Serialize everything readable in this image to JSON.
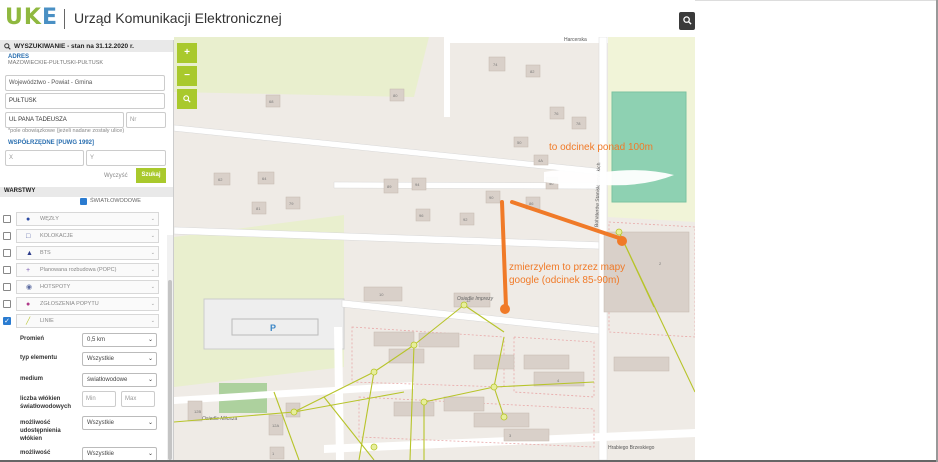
{
  "header": {
    "logo_u": "U",
    "logo_k": "K",
    "logo_e": "E",
    "title": "Urząd Komunikacji Elektronicznej",
    "search_icon": "search-icon"
  },
  "map": {
    "streets": [
      "Harcerska",
      "Bohaterów Stanisławowskich",
      "Hrabiego Brzeskiego"
    ],
    "places": [
      "Osiedle Imprezy",
      "Osiedle Miłosza"
    ],
    "house_numbers": [
      "68",
      "80",
      "74",
      "82",
      "76",
      "78",
      "62",
      "64",
      "79",
      "81",
      "89",
      "94",
      "96",
      "92",
      "90",
      "86",
      "40",
      "50",
      "4A",
      "10",
      "12",
      "48",
      "12B",
      "12A",
      "1",
      "2",
      "3",
      "4"
    ],
    "parking_label": "P",
    "colors": {
      "background": "#efebe6",
      "road": "#ffffff",
      "building": "#d9d0c9",
      "green": "#add19e",
      "sport": "#8ed1b2",
      "field": "#e9efce",
      "fiber_line": "#b7c42a",
      "annotation": "#f07a28",
      "parcel": "#e8a8a8"
    },
    "zoom_in": "+",
    "zoom_out": "−",
    "locate": "locate-icon"
  },
  "annotations": {
    "top": "to odcinek ponad 100m",
    "bottom": "zmierzylem to przez mapy google (odcinek 85-90m)"
  },
  "search_panel": {
    "title": "WYSZUKIWANIE - stan na 31.12.2020 r.",
    "address_label": "ADRES",
    "location": "MAZOWIECKIE-PUŁTUSKI-PUŁTUSK",
    "region_placeholder": "Województwo - Powiat - Gmina",
    "city_value": "PUŁTUSK",
    "street_value": "UL PANA TADEUSZA",
    "number_placeholder": "Nr",
    "required_note": "*pole obowiązkowe (jeżeli nadane zostały ulice)",
    "coords_label": "WSPÓŁRZĘDNE [PUWG 1992]",
    "x_placeholder": "X",
    "y_placeholder": "Y",
    "clear_label": "Wyczyść",
    "search_label": "Szukaj"
  },
  "layers": {
    "title": "WARSTWY",
    "items": [
      {
        "label": "ŚWIATŁOWODOWE",
        "checked": true,
        "icon": "checkbox-icon"
      },
      {
        "label": "WĘZŁY",
        "checked": false,
        "icon": "dot-icon",
        "color": "#2b4aa3"
      },
      {
        "label": "KOLOKACJE",
        "checked": false,
        "icon": "square-icon",
        "color": "#4a5aa0"
      },
      {
        "label": "BTS",
        "checked": false,
        "icon": "triangle-icon",
        "color": "#2b3b8a"
      },
      {
        "label": "Planowana rozbudowa (POPC)",
        "checked": false,
        "icon": "plus-icon",
        "color": "#7a5ab0"
      },
      {
        "label": "HOTSPOTY",
        "checked": false,
        "icon": "wifi-icon",
        "color": "#5a6aa0"
      },
      {
        "label": "ZGŁOSZENIA POPYTU",
        "checked": false,
        "icon": "dot-icon",
        "color": "#b03a8a"
      },
      {
        "label": "LINIE",
        "checked": true,
        "icon": "line-icon",
        "color": "#b7c42a"
      }
    ]
  },
  "filters": {
    "radius_label": "Promień",
    "radius_value": "0,5 km",
    "element_type_label": "typ elementu",
    "element_type_value": "Wszystkie",
    "medium_label": "medium",
    "medium_value": "światłowodowe",
    "fiber_count_label": "liczba włókien światłowodowych",
    "min_placeholder": "Min",
    "max_placeholder": "Max",
    "sharing_label": "możliwość udostępnienia włókien",
    "sharing_value": "Wszystkie",
    "other_label": "możliwość",
    "other_value": "Wszystkie"
  }
}
